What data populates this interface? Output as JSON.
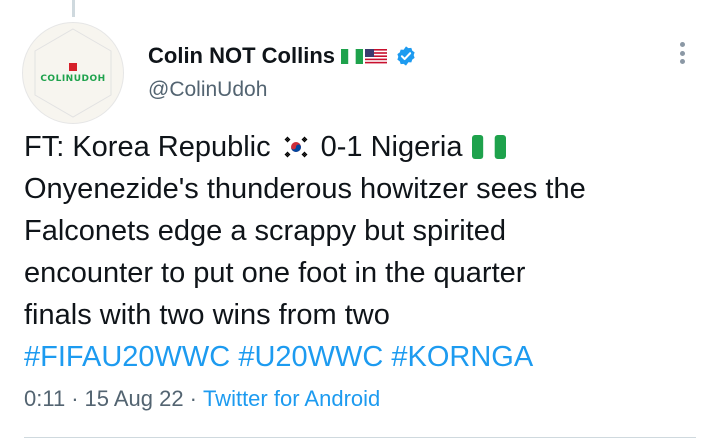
{
  "author": {
    "display_name": "Colin NOT Collins",
    "handle": "@ColinUdoh",
    "avatar_text": "COLINUDOH",
    "verified": true,
    "flags": [
      "nigeria-flag",
      "usa-flag"
    ]
  },
  "tweet": {
    "line1_prefix": "FT: Korea Republic",
    "line1_score": "0-1 Nigeria",
    "line2": "Onyenezide's thunderous howitzer sees the",
    "line3": "Falconets edge a scrappy but spirited",
    "line4": "encounter to put one foot in the quarter",
    "line5": "finals with two wins from two",
    "hashtags": [
      "#FIFAU20WWC",
      "#U20WWC",
      "#KORNGA"
    ]
  },
  "meta": {
    "time": "0:11",
    "separator": "·",
    "date": "15 Aug 22",
    "source": "Twitter for Android"
  },
  "colors": {
    "link": "#1d9bf0",
    "text": "#0f1419",
    "secondary": "#536471",
    "verified": "#1d9bf0"
  }
}
